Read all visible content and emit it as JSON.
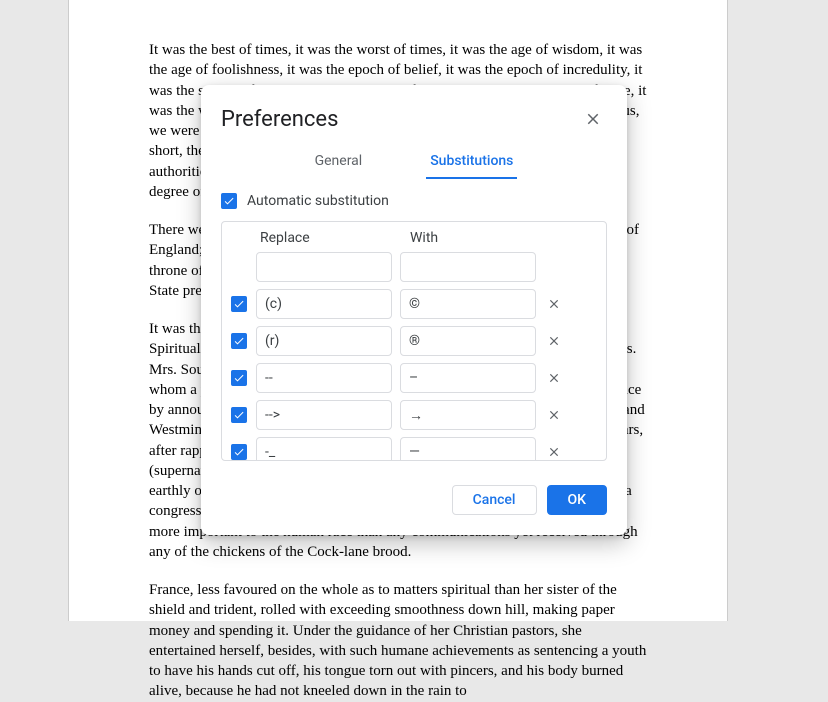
{
  "document": {
    "paragraphs": [
      "It was the best of times, it was the worst of times, it was the age of wisdom, it was the age of foolishness, it was the epoch of belief, it was the epoch of incredulity, it was the season of Light, it was the season of Darkness, it was the spring of hope, it was the winter of despair, we had everything before us, we had nothing before us, we were all going direct to Heaven, we were all going direct the other way—in short, the period was so far like the present period, that some of its noisiest authorities insisted on its being received, for good or for evil, in the superlative degree of comparison only.",
      "There were a king with a large jaw and a queen with a plain face, on the throne of England; there were a king with a large jaw and a queen with a fair face, on the throne of France. In both countries it was clearer than crystal to the lords of the State preserves of loaves and fishes, that things in general were settled for ever.",
      "It was the year of Our Lord one thousand seven hundred and seventy-five. Spiritual revelations were conceded to England at that favoured period, as at this. Mrs. Southcott had recently attained her five-and-twentieth blessed birthday, of whom a prophetic private in the Life Guards had heralded the sublime appearance by announcing that arrangements were made for the swallowing up of London and Westminster. Even the Cock-lane ghost had been laid only a round dozen of years, after rapping out its messages, as the spirits of this very year last past (supernaturally deficient in originality) rapped out theirs. Mere messages in the earthly order of events had lately come to the English Crown and People, from a congress of British subjects in America: which, strange to relate, have proved more important to the human race than any communications yet received through any of the chickens of the Cock-lane brood.",
      "France, less favoured on the whole as to matters spiritual than her sister of the shield and trident, rolled with exceeding smoothness down hill, making paper money and spending it. Under the guidance of her Christian pastors, she entertained herself, besides, with such humane achievements as sentencing a youth to have his hands cut off, his tongue torn out with pincers, and his body burned alive, because he had not kneeled down in the rain to"
    ]
  },
  "modal": {
    "title": "Preferences",
    "tabs": {
      "general": "General",
      "substitutions": "Substitutions"
    },
    "auto_sub_label": "Automatic substitution",
    "columns": {
      "replace": "Replace",
      "with": "With"
    },
    "rows": [
      {
        "enabled": true,
        "replace": "(c)",
        "with": "©"
      },
      {
        "enabled": true,
        "replace": "(r)",
        "with": "®"
      },
      {
        "enabled": true,
        "replace": "--",
        "with": "–"
      },
      {
        "enabled": true,
        "replace": "-->",
        "with": "→"
      },
      {
        "enabled": true,
        "replace": "-_",
        "with": "—"
      }
    ],
    "buttons": {
      "cancel": "Cancel",
      "ok": "OK"
    }
  }
}
